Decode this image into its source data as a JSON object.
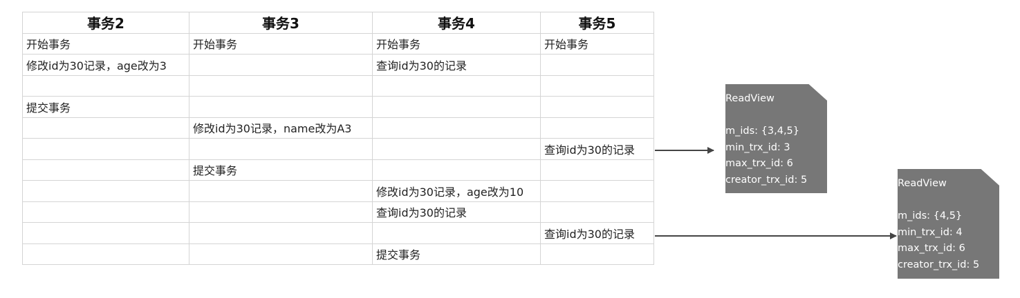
{
  "table": {
    "headers": [
      "事务2",
      "事务3",
      "事务4",
      "事务5"
    ],
    "rows": [
      [
        "开始事务",
        "开始事务",
        "开始事务",
        "开始事务"
      ],
      [
        "修改id为30记录，age改为3",
        "",
        "查询id为30的记录",
        ""
      ],
      [
        "",
        "",
        "",
        ""
      ],
      [
        "提交事务",
        "",
        "",
        ""
      ],
      [
        "",
        "修改id为30记录，name改为A3",
        "",
        ""
      ],
      [
        "",
        "",
        "",
        "查询id为30的记录"
      ],
      [
        "",
        "提交事务",
        "",
        ""
      ],
      [
        "",
        "",
        "修改id为30记录，age改为10",
        ""
      ],
      [
        "",
        "",
        "查询id为30的记录",
        ""
      ],
      [
        "",
        "",
        "",
        "查询id为30的记录"
      ],
      [
        "",
        "",
        "提交事务",
        ""
      ]
    ]
  },
  "readviews": [
    {
      "title": "ReadView",
      "lines": [
        "m_ids: {3,4,5}",
        "min_trx_id: 3",
        "max_trx_id: 6",
        "creator_trx_id: 5"
      ]
    },
    {
      "title": "ReadView",
      "lines": [
        "m_ids: {4,5}",
        "min_trx_id: 4",
        "max_trx_id: 6",
        "creator_trx_id: 5"
      ]
    }
  ]
}
